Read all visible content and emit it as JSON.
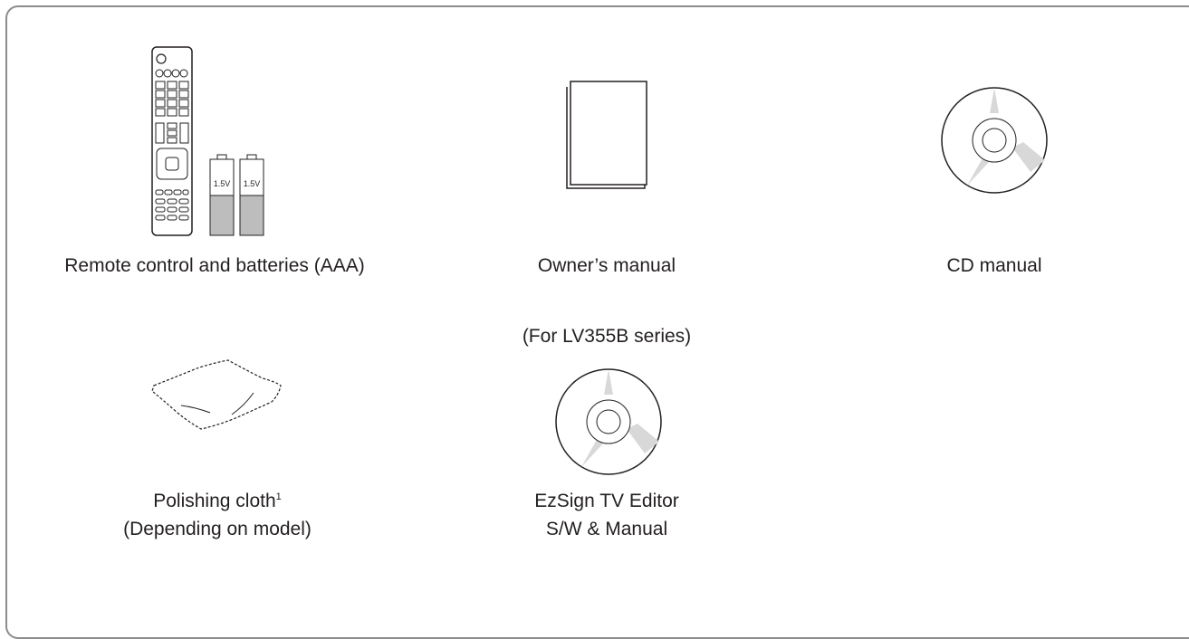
{
  "items": {
    "remote": {
      "label": "Remote control and batteries (AAA)",
      "battery_text": "1.5V",
      "icon": "remote-control-and-batteries"
    },
    "manual": {
      "label": "Owner’s manual",
      "icon": "booklet"
    },
    "cd": {
      "label": "CD manual",
      "icon": "compact-disc"
    },
    "cloth": {
      "label_line1": "Polishing cloth",
      "footnote": "1",
      "label_line2": "(Depending on model)",
      "icon": "polishing-cloth"
    },
    "ezsign": {
      "note": "(For LV355B series)",
      "label_line1": "EzSign TV Editor",
      "label_line2": "S/W & Manual",
      "icon": "compact-disc"
    }
  },
  "colors": {
    "border": "#8c8c8c",
    "line": "#231f20",
    "shade": "#d8d8d8",
    "battery_fill": "#bdbdbd"
  }
}
